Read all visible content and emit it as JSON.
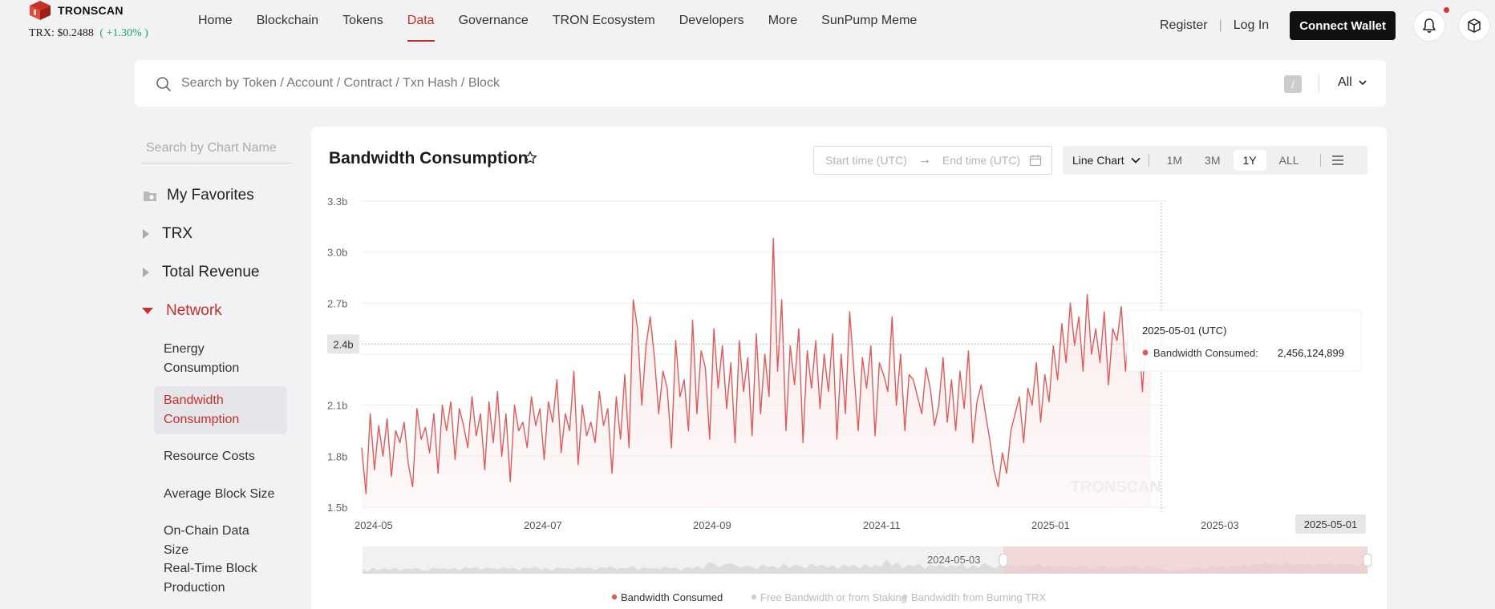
{
  "header": {
    "brand": "TRONSCAN",
    "price_label": "TRX: $0.2488",
    "price_change": "( +1.30% )",
    "nav": [
      {
        "label": "Home",
        "active": false
      },
      {
        "label": "Blockchain",
        "active": false
      },
      {
        "label": "Tokens",
        "active": false
      },
      {
        "label": "Data",
        "active": true
      },
      {
        "label": "Governance",
        "active": false
      },
      {
        "label": "TRON Ecosystem",
        "active": false
      },
      {
        "label": "Developers",
        "active": false
      },
      {
        "label": "More",
        "active": false
      },
      {
        "label": "SunPump Meme",
        "active": false
      }
    ],
    "register": "Register",
    "login": "Log In",
    "connect": "Connect Wallet"
  },
  "search": {
    "placeholder": "Search by Token / Account / Contract / Txn Hash / Block",
    "shortcut": "/",
    "scope": "All"
  },
  "sidebar": {
    "search_placeholder": "Search by Chart Name",
    "favorites": "My Favorites",
    "groups": [
      "TRX",
      "Total Revenue",
      "Network"
    ],
    "network_items": [
      "Energy Consumption",
      "Bandwidth Consumption",
      "Resource Costs",
      "Average Block Size",
      "On-Chain Data Size",
      "Real-Time Block Production"
    ]
  },
  "card": {
    "title": "Bandwidth Consumption",
    "start_placeholder": "Start time (UTC)",
    "end_placeholder": "End time (UTC)",
    "chart_type": "Line Chart",
    "ranges": [
      {
        "label": "1M",
        "active": false
      },
      {
        "label": "3M",
        "active": false
      },
      {
        "label": "1Y",
        "active": true
      },
      {
        "label": "ALL",
        "active": false
      }
    ]
  },
  "colors": {
    "accent": "#c53028",
    "line": "#e05a5a"
  },
  "chart_data": {
    "type": "line",
    "title": "Bandwidth Consumption",
    "y_ticks": [
      "1.5b",
      "1.8b",
      "2.1b",
      "2.4b",
      "2.7b",
      "3.0b",
      "3.3b"
    ],
    "ylim": [
      1.5,
      3.3
    ],
    "y_unit": "billion",
    "x_ticks": [
      "2024-05",
      "2024-07",
      "2024-09",
      "2024-11",
      "2025-01",
      "2025-03"
    ],
    "x_range": [
      "2024-05-01",
      "2025-05-01"
    ],
    "crosshair_y_label": "2.4b",
    "crosshair_x_label": "2025-05-01",
    "tooltip": {
      "date": "2025-05-01 (UTC)",
      "series": "Bandwidth Consumed:",
      "value": "2,456,124,899"
    },
    "slider_label": "2024-05-03",
    "legend": [
      {
        "name": "Bandwidth Consumed",
        "active": true
      },
      {
        "name": "Free Bandwidth or from Staking",
        "active": false
      },
      {
        "name": "Bandwidth from Burning TRX",
        "active": false
      }
    ],
    "watermark": "TRONSCAN",
    "series": [
      {
        "name": "Bandwidth Consumed",
        "values": [
          1.85,
          1.58,
          2.05,
          1.72,
          1.98,
          1.8,
          2.02,
          1.68,
          1.95,
          1.88,
          2.0,
          1.75,
          1.62,
          2.08,
          1.9,
          1.97,
          1.82,
          2.05,
          1.7,
          2.1,
          1.95,
          2.12,
          1.78,
          2.08,
          1.98,
          1.85,
          2.15,
          1.92,
          2.05,
          1.72,
          2.12,
          1.88,
          2.18,
          1.8,
          2.05,
          1.65,
          2.1,
          1.95,
          2.0,
          1.85,
          2.15,
          1.98,
          2.08,
          1.78,
          2.12,
          2.0,
          2.25,
          1.82,
          2.05,
          1.95,
          2.3,
          1.75,
          2.1,
          1.92,
          2.0,
          1.88,
          2.18,
          1.98,
          2.08,
          1.7,
          2.15,
          1.9,
          2.28,
          1.85,
          2.72,
          2.55,
          2.1,
          2.45,
          2.62,
          2.38,
          2.05,
          2.3,
          2.2,
          1.85,
          2.48,
          2.15,
          2.25,
          1.95,
          2.6,
          2.05,
          2.42,
          2.32,
          1.9,
          2.55,
          2.2,
          2.45,
          2.08,
          2.35,
          1.88,
          2.48,
          2.18,
          2.38,
          1.92,
          2.52,
          2.05,
          2.4,
          2.15,
          3.08,
          2.3,
          2.72,
          1.95,
          2.45,
          2.22,
          2.55,
          1.88,
          2.42,
          2.2,
          2.48,
          2.08,
          2.4,
          2.18,
          2.52,
          1.9,
          2.4,
          2.05,
          2.65,
          2.3,
          1.95,
          2.38,
          2.2,
          2.45,
          1.92,
          2.35,
          2.28,
          2.18,
          2.62,
          2.1,
          2.4,
          1.95,
          2.28,
          2.25,
          2.15,
          2.05,
          2.32,
          2.2,
          1.98,
          2.1,
          2.38,
          2.0,
          2.25,
          1.95,
          2.3,
          2.08,
          2.42,
          1.88,
          2.12,
          2.22,
          2.05,
          1.9,
          1.72,
          1.62,
          1.82,
          1.7,
          1.95,
          2.05,
          2.15,
          1.88,
          2.2,
          2.1,
          2.35,
          2.0,
          2.28,
          2.12,
          2.45,
          2.25,
          2.58,
          2.35,
          2.7,
          2.45,
          2.62,
          2.3,
          2.75,
          2.4,
          2.55,
          2.35,
          2.65,
          2.22,
          2.55,
          2.48,
          2.68,
          2.3,
          2.62,
          2.4,
          2.58,
          2.18,
          2.6,
          2.46
        ]
      }
    ]
  }
}
